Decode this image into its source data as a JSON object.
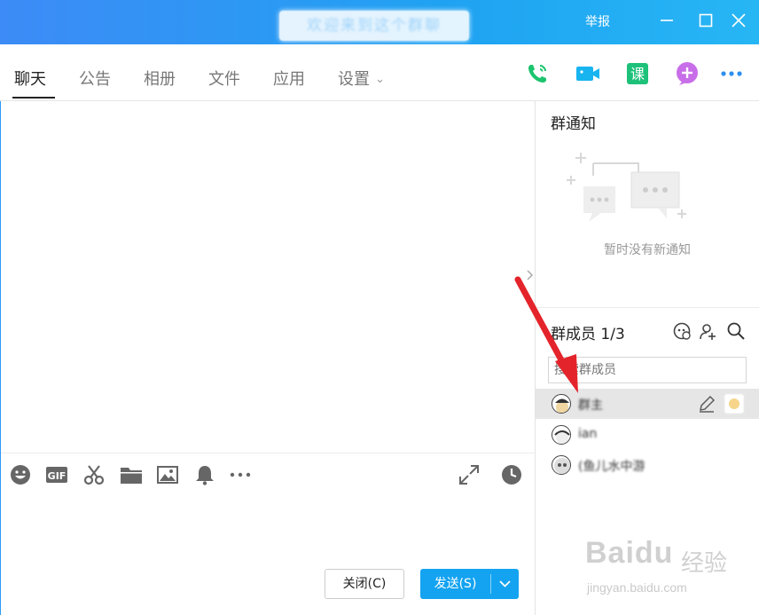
{
  "window": {
    "title": "欢迎来到这个群聊",
    "report_label": "举报"
  },
  "tabs": [
    {
      "label": "聊天"
    },
    {
      "label": "公告"
    },
    {
      "label": "相册"
    },
    {
      "label": "文件"
    },
    {
      "label": "应用"
    },
    {
      "label": "设置"
    }
  ],
  "colors": {
    "titlebar_start": "#3d8bf6",
    "titlebar_end": "#27b6f4",
    "send_button": "#14a3f0",
    "phone_icon": "#1bc46d",
    "video_icon": "#18b4f0",
    "course_icon": "#1dc17a",
    "plus_icon": "#c86ee8",
    "more_icon": "#2e8ff0",
    "arrow": "#e4242b"
  },
  "toolbar_icons": [
    "emoji-icon",
    "gif-icon",
    "scissors-icon",
    "folder-icon",
    "image-icon",
    "bell-icon",
    "more-icon"
  ],
  "course_label": "课",
  "gif_label": "GIF",
  "buttons": {
    "close": "关闭(C)",
    "send": "发送(S)"
  },
  "notice": {
    "title": "群通知",
    "empty_text": "暂时没有新通知"
  },
  "members": {
    "title": "群成员 1/3",
    "search_placeholder": "搜索群成员",
    "list": [
      {
        "name": "群主"
      },
      {
        "name": "ian"
      },
      {
        "name": "(鱼儿水中游"
      }
    ]
  },
  "watermark": {
    "brand": "Baidu",
    "cn": "经验",
    "url": "jingyan.baidu.com"
  }
}
